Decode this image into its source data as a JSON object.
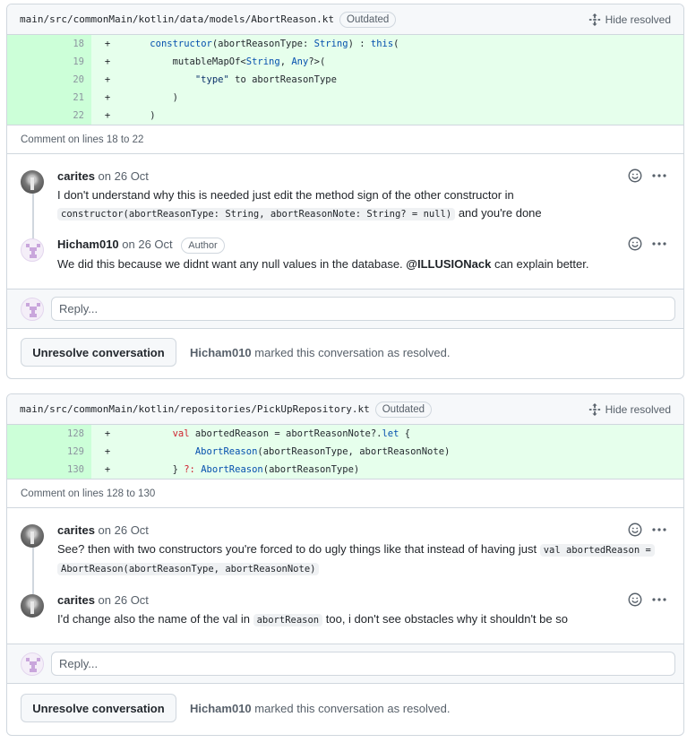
{
  "threads": [
    {
      "file_path": "main/src/commonMain/kotlin/data/models/AbortReason.kt",
      "badge": "Outdated",
      "hide_resolved": "Hide resolved",
      "lines": [
        {
          "n": "18",
          "sign": "+"
        },
        {
          "n": "19",
          "sign": "+"
        },
        {
          "n": "20",
          "sign": "+"
        },
        {
          "n": "21",
          "sign": "+"
        },
        {
          "n": "22",
          "sign": "+"
        }
      ],
      "comment_on": "Comment on lines 18 to 22",
      "comments": [
        {
          "author": "carites",
          "date": "on 26 Oct",
          "body_text": "I don't understand why this is needed just edit the method sign of the other constructor in",
          "body_code": "constructor(abortReasonType: String, abortReasonNote: String? = null)",
          "body_tail": "and you're done"
        },
        {
          "author": "Hicham010",
          "date": "on 26 Oct",
          "role": "Author",
          "body_text": "We did this because we didnt want any null values in the database.",
          "mention": "@ILLUSIONack",
          "body_tail": "can explain better."
        }
      ],
      "reply_placeholder": "Reply...",
      "unresolve_label": "Unresolve conversation",
      "resolved_by": "Hicham010",
      "resolved_text": "marked this conversation as resolved."
    },
    {
      "file_path": "main/src/commonMain/kotlin/repositories/PickUpRepository.kt",
      "badge": "Outdated",
      "hide_resolved": "Hide resolved",
      "lines": [
        {
          "n": "128",
          "sign": "+"
        },
        {
          "n": "129",
          "sign": "+"
        },
        {
          "n": "130",
          "sign": "+"
        }
      ],
      "comment_on": "Comment on lines 128 to 130",
      "comments": [
        {
          "author": "carites",
          "date": "on 26 Oct",
          "body_text": "See? then with two constructors you're forced to do ugly things like that instead of having just",
          "body_code": "val abortedReason =",
          "body_code2": "AbortReason(abortReasonType, abortReasonNote)"
        },
        {
          "author": "carites",
          "date": "on 26 Oct",
          "body_text": "I'd change also the name of the val in",
          "body_code": "abortReason",
          "body_tail": "too, i don't see obstacles why it shouldn't be so"
        }
      ],
      "reply_placeholder": "Reply...",
      "unresolve_label": "Unresolve conversation",
      "resolved_by": "Hicham010",
      "resolved_text": "marked this conversation as resolved."
    }
  ],
  "code": {
    "t0": [
      [
        "    ",
        "constructor",
        "(abortReasonType: ",
        "String",
        ") : ",
        "this",
        "("
      ],
      [
        "        mutableMapOf<",
        "String",
        ", ",
        "Any",
        "?>("
      ],
      [
        "            ",
        "\"type\"",
        " to abortReasonType"
      ],
      [
        "        )"
      ],
      [
        "    )"
      ]
    ],
    "t1": [
      [
        "        ",
        "val",
        " abortedReason = abortReasonNote?.",
        "let",
        " {"
      ],
      [
        "            ",
        "AbortReason",
        "(abortReasonType, abortReasonNote)"
      ],
      [
        "        } ",
        "?:",
        " ",
        "AbortReason",
        "(abortReasonType)"
      ]
    ]
  },
  "icons": {
    "hide_resolved": "unfold-icon",
    "reaction": "smiley-icon",
    "menu": "kebab-horizontal-icon"
  }
}
